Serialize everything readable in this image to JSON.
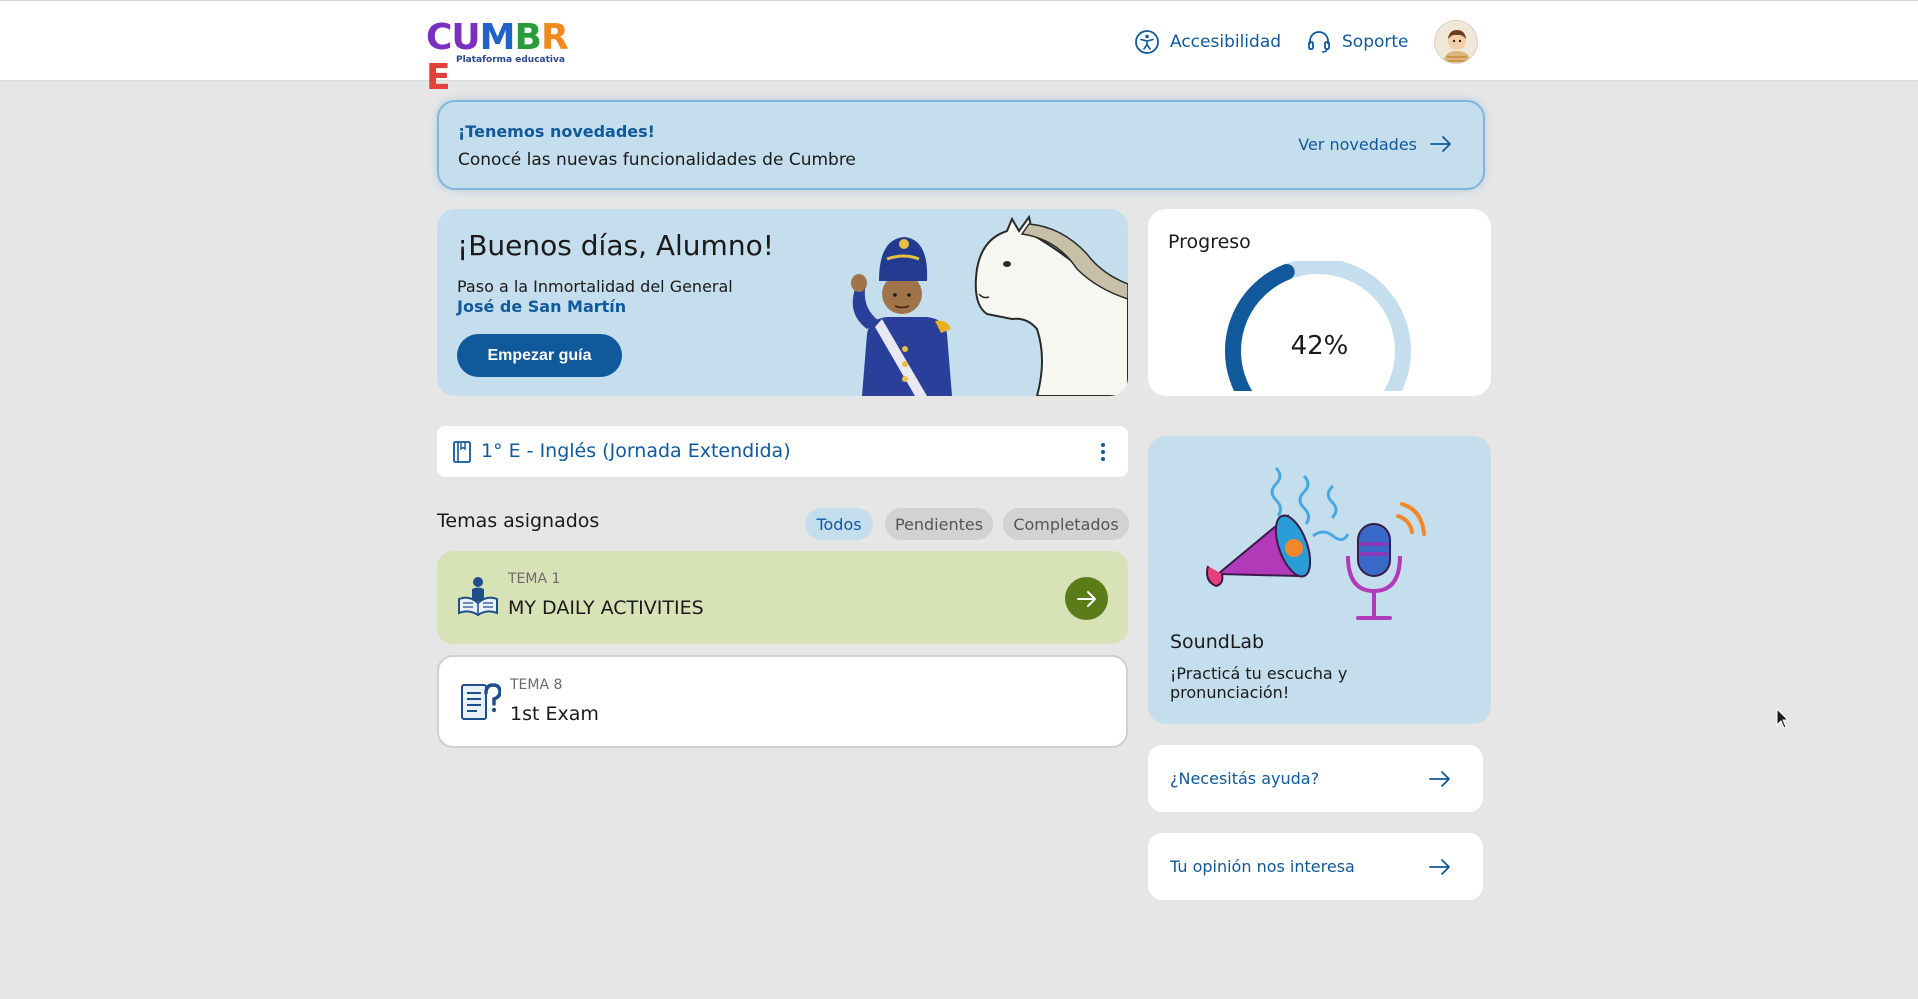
{
  "header": {
    "logo_letters": [
      "C",
      "U",
      "M",
      "B",
      "R",
      "E"
    ],
    "logo_colors": [
      "#7b2fbf",
      "#7b2fbf",
      "#1f63c8",
      "#2a9d3a",
      "#f08a1c",
      "#e0413a"
    ],
    "logo_subtitle": "Plataforma educativa",
    "accessibility_label": "Accesibilidad",
    "support_label": "Soporte"
  },
  "announcement": {
    "title": "¡Tenemos novedades!",
    "text": "Conocé las nuevas funcionalidades de Cumbre",
    "link_label": "Ver novedades"
  },
  "welcome": {
    "title": "¡Buenos días, Alumno!",
    "subtitle": "Paso a la Inmortalidad del General",
    "hero_name": "José de San Martín",
    "button_label": "Empezar guía"
  },
  "progress": {
    "title": "Progreso",
    "value_label": "42%",
    "value": 0.42
  },
  "course": {
    "label": "1° E - Inglés (Jornada Extendida)"
  },
  "topics": {
    "title": "Temas asignados",
    "filters": [
      "Todos",
      "Pendientes",
      "Completados"
    ],
    "active_filter": "Todos",
    "items": [
      {
        "kicker": "TEMA 1",
        "name": "MY DAILY ACTIVITIES"
      },
      {
        "kicker": "TEMA 8",
        "name": "1st Exam"
      }
    ]
  },
  "soundlab": {
    "title": "SoundLab",
    "text": "¡Practicá tu escucha y pronunciación!"
  },
  "links": {
    "help_label": "¿Necesitás ayuda?",
    "feedback_label": "Tu opinión nos interesa"
  },
  "colors": {
    "primary": "#10599a",
    "card_blue": "#c5deed",
    "topic_green": "#d7e2b7",
    "arrow_green": "#5a7d1a",
    "background": "#e6e6e6"
  }
}
